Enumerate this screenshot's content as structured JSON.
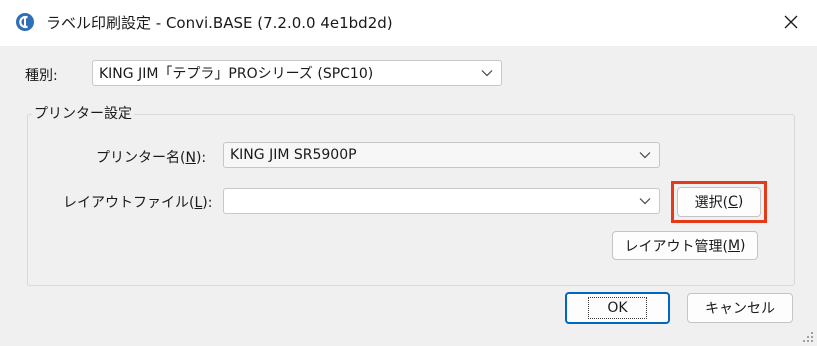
{
  "window": {
    "title": "ラベル印刷設定 - Convi.BASE (7.2.0.0 4e1bd2d)",
    "close_glyph": "✕"
  },
  "type_field": {
    "label": "種別:",
    "value": "KING JIM「テプラ」PROシリーズ (SPC10)"
  },
  "printer_group": {
    "legend": "プリンター設定",
    "printer_name": {
      "label_prefix": "プリンター名(",
      "label_key": "N",
      "label_suffix": "):",
      "value": "KING JIM SR5900P"
    },
    "layout_file": {
      "label_prefix": "レイアウトファイル(",
      "label_key": "L",
      "label_suffix": "):",
      "value": ""
    },
    "select_button": {
      "label_prefix": "選択(",
      "label_key": "C",
      "label_suffix": ")"
    },
    "layout_manage_button": {
      "label_prefix": "レイアウト管理(",
      "label_key": "M",
      "label_suffix": ")"
    }
  },
  "footer": {
    "ok_label": "OK",
    "cancel_label": "キャンセル"
  },
  "colors": {
    "accent": "#0067c0",
    "highlight": "#e53a1a",
    "client_bg": "#f0f0f0"
  },
  "icons": [
    "app-icon",
    "close-icon",
    "chevron-down-icon",
    "resize-grip-icon"
  ]
}
